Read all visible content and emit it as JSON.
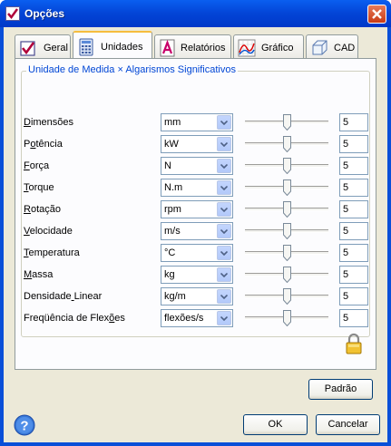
{
  "window": {
    "title": "Opções",
    "icons": {
      "app": "checkbox-app-icon",
      "close": "close-icon"
    }
  },
  "tabs": [
    {
      "label": "Geral",
      "icon": "checkbox-icon",
      "active": false
    },
    {
      "label": "Unidades",
      "icon": "calculator-icon",
      "active": true
    },
    {
      "label": "Relatórios",
      "icon": "report-A-icon",
      "active": false
    },
    {
      "label": "Gráfico",
      "icon": "chart-icon",
      "active": false
    },
    {
      "label": "CAD",
      "icon": "cube-icon",
      "active": false
    }
  ],
  "group": {
    "title": "Unidade de Medida × Algarismos Significativos"
  },
  "rows": [
    {
      "label": "Dimensões",
      "unit": "mm",
      "digits": "5",
      "slider_value": 5
    },
    {
      "label": "Potência",
      "unit": "kW",
      "digits": "5",
      "slider_value": 5
    },
    {
      "label": "Força",
      "unit": "N",
      "digits": "5",
      "slider_value": 5
    },
    {
      "label": "Torque",
      "unit": "N.m",
      "digits": "5",
      "slider_value": 5
    },
    {
      "label": "Rotação",
      "unit": "rpm",
      "digits": "5",
      "slider_value": 5
    },
    {
      "label": "Velocidade",
      "unit": "m/s",
      "digits": "5",
      "slider_value": 5
    },
    {
      "label": "Temperatura",
      "unit": "°C",
      "digits": "5",
      "slider_value": 5
    },
    {
      "label": "Massa",
      "unit": "kg",
      "digits": "5",
      "slider_value": 5
    },
    {
      "label": "Densidade Linear",
      "unit": "kg/m",
      "digits": "5",
      "slider_value": 5
    },
    {
      "label": "Freqüência de Flexões",
      "unit": "flexões/s",
      "digits": "5",
      "slider_value": 5
    }
  ],
  "icons": {
    "lock": "lock-icon",
    "help": "help-icon",
    "dropdown": "chevron-down-icon"
  },
  "buttons": {
    "default": "Padrão",
    "ok": "OK",
    "cancel": "Cancelar"
  }
}
